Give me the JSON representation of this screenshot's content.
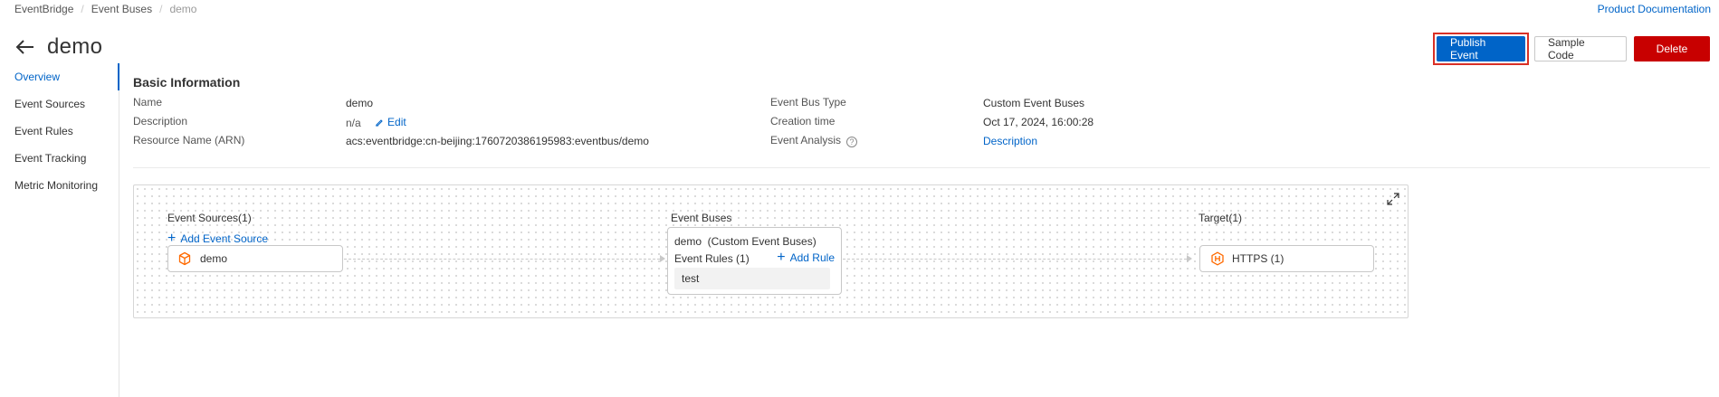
{
  "breadcrumb": [
    "EventBridge",
    "Event Buses",
    "demo"
  ],
  "header": {
    "doc_link": "Product Documentation",
    "title": "demo",
    "actions": {
      "publish": "Publish Event",
      "sample": "Sample Code",
      "delete": "Delete"
    }
  },
  "sidenav": [
    "Overview",
    "Event Sources",
    "Event Rules",
    "Event Tracking",
    "Metric Monitoring"
  ],
  "basic_info": {
    "section_title": "Basic Information",
    "name_label": "Name",
    "name_value": "demo",
    "description_label": "Description",
    "description_value": "n/a",
    "edit_label": "Edit",
    "arn_label": "Resource Name (ARN)",
    "arn_value": "acs:eventbridge:cn-beijing:1760720386195983:eventbus/demo",
    "bus_type_label": "Event Bus Type",
    "bus_type_value": "Custom Event Buses",
    "creation_label": "Creation time",
    "creation_value": "Oct 17, 2024, 16:00:28",
    "analysis_label": "Event Analysis",
    "analysis_help": "?",
    "analysis_value": "Description"
  },
  "topology": {
    "sources_title": "Event Sources(1)",
    "add_source": "Add Event Source",
    "source_node": "demo",
    "buses_title": "Event Buses",
    "bus_name": "demo  (Custom Event Buses)",
    "rules_label": "Event Rules (1)",
    "add_rule": "Add Rule",
    "rule_item": "test",
    "target_title": "Target(1)",
    "target_node": "HTTPS (1)"
  },
  "colors": {
    "accent": "#0064c8",
    "danger": "#c80000",
    "source_icon": "#ff6a00"
  }
}
